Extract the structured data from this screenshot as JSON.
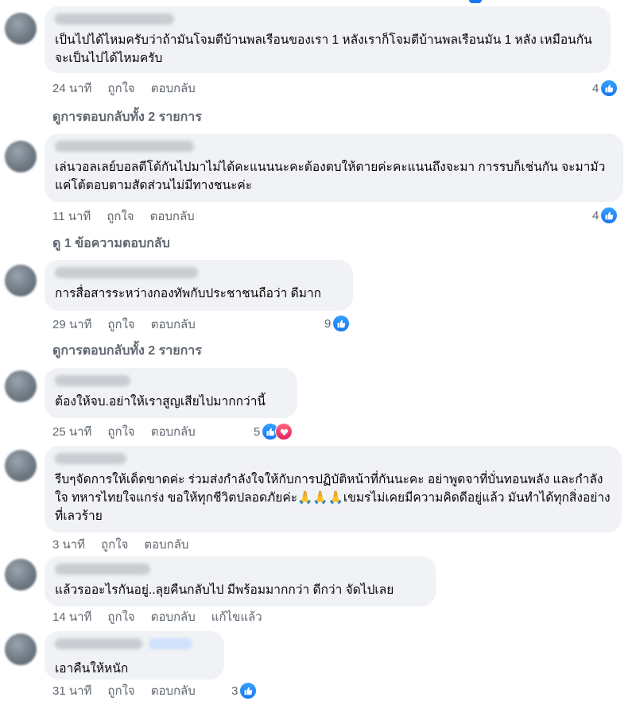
{
  "comments": [
    {
      "text": "เป็นไปได้ไหมครับว่าถ้ามันโจมตีบ้านพลเรือนของเรา 1 หลังเราก็โจมตีบ้านพลเรือนมัน 1 หลัง เหมือนกันจะเป็นไปได้ไหมครับ",
      "time": "24 นาที",
      "like": "ถูกใจ",
      "reply": "ตอบกลับ",
      "reactions": "4",
      "view_replies": "ดูการตอบกลับทั้ง 2 รายการ"
    },
    {
      "text": "เล่นวอลเลย์บอลตีโต้กันไปมาไม่ได้คะแนนนะคะต้องตบให้ตายค่ะคะแนนถึงจะมา การรบก็เช่นกัน จะมามัวแค่โต้ตอบตามสัดส่วนไม่มีทางชนะค่ะ",
      "time": "11 นาที",
      "like": "ถูกใจ",
      "reply": "ตอบกลับ",
      "reactions": "4",
      "view_replies": "ดู 1 ข้อความตอบกลับ"
    },
    {
      "text": "การสื่อสารระหว่างกองทัพกับประชาชนถือว่า ดีมาก",
      "time": "29 นาที",
      "like": "ถูกใจ",
      "reply": "ตอบกลับ",
      "reactions": "9",
      "view_replies": "ดูการตอบกลับทั้ง 2 รายการ"
    },
    {
      "text": "ต้องให้จบ.อย่าให้เราสูญเสียไปมากกว่านี้",
      "time": "25 นาที",
      "like": "ถูกใจ",
      "reply": "ตอบกลับ",
      "reactions": "5"
    },
    {
      "text": "รีบๆจัดการให้เด็ดขาดค่ะ ร่วมส่งกำลังใจให้กับการปฏิบัติหน้าที่กันนะคะ อย่าพูดจาที่บั่นทอนพลัง และกำลังใจ ทหารไทยใจแกร่ง ขอให้ทุกชีวิตปลอดภัยค่ะ🙏🙏🙏เขมรไม่เคยมีความคิดดีอยู่แล้ว มันทำได้ทุกสิ่งอย่างที่เลวร้าย",
      "time": "3 นาที",
      "like": "ถูกใจ",
      "reply": "ตอบกลับ"
    },
    {
      "text": "แล้วรออะไรกันอยู่..ลุยคืนกลับไป มีพร้อมมากกว่า ดีกว่า จัดไปเลย",
      "time": "14 นาที",
      "like": "ถูกใจ",
      "reply": "ตอบกลับ",
      "edited": "แก้ไขแล้ว"
    },
    {
      "text": "เอาคืนให้หนัก",
      "time": "31 นาที",
      "like": "ถูกใจ",
      "reply": "ตอบกลับ",
      "reactions": "3"
    }
  ],
  "colors": {
    "bubble": "#f0f2f5",
    "like_blue": "#1877f2",
    "love_red": "#e0245e",
    "meta_text": "#606770"
  },
  "icons": {
    "like": "thumbs-up-icon",
    "love": "heart-icon"
  }
}
